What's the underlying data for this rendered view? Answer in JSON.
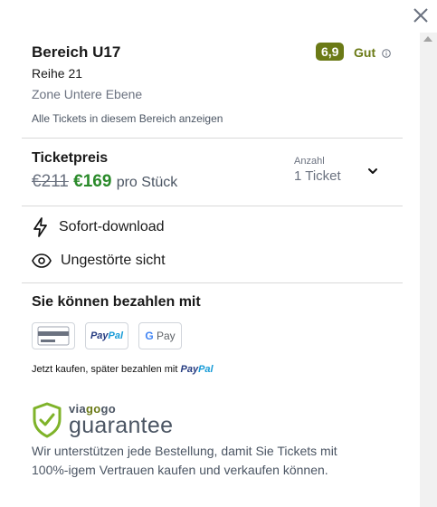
{
  "listing": {
    "area": "Bereich U17",
    "row": "Reihe 21",
    "zone": "Zone Untere Ebene",
    "all_tickets_link": "Alle Tickets in diesem Bereich anzeigen",
    "rating_value": "6,9",
    "rating_label": "Gut",
    "rating_color": "#6b7a16"
  },
  "price": {
    "title": "Ticketpreis",
    "old_price": "€211",
    "new_price": "€169",
    "per_unit": "pro Stück",
    "quantity_label": "Anzahl",
    "quantity_value": "1 Ticket",
    "new_price_color": "#2a8a2a"
  },
  "features": [
    {
      "icon": "lightning-icon",
      "label": "Sofort-download"
    },
    {
      "icon": "eye-icon",
      "label": "Ungestörte sicht"
    }
  ],
  "payment": {
    "title": "Sie können bezahlen mit",
    "methods": [
      "card-icon",
      "paypal-logo",
      "google-pay-logo"
    ],
    "paypal_label_a": "Pay",
    "paypal_label_b": "Pal",
    "gpay_g": "G",
    "gpay_pay": "Pay",
    "pay_later_text": "Jetzt kaufen, später bezahlen mit"
  },
  "guarantee": {
    "brand_a": "via",
    "brand_b": "go",
    "brand_c": "go",
    "word": "guarantee",
    "text": "Wir unterstützen jede Bestellung, damit Sie Tickets mit 100%-igem Vertrauen kaufen und verkaufen können."
  }
}
